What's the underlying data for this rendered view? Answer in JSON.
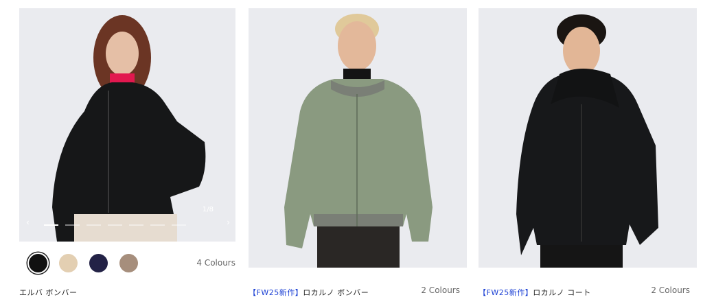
{
  "products": [
    {
      "name": "エルバ ボンバー",
      "tag": "",
      "colours": "4 Colours",
      "counter": "1/8",
      "prev_icon": "‹",
      "next_icon": "›",
      "swatches": [
        "#111111",
        "#e3cfb2",
        "#232246",
        "#a68e7c"
      ],
      "selected_swatch": 0
    },
    {
      "name": "ロカルノ ボンバー",
      "tag": "【FW25新作】",
      "colours": "2 Colours"
    },
    {
      "name": "ロカルノ コート",
      "tag": "【FW25新作】",
      "colours": "2 Colours"
    }
  ],
  "colors": {
    "photo_bg": "#eaebef",
    "tag": "#1a3fd4",
    "jacket_black": "#161718",
    "jacket_green": "#8a9a80"
  }
}
